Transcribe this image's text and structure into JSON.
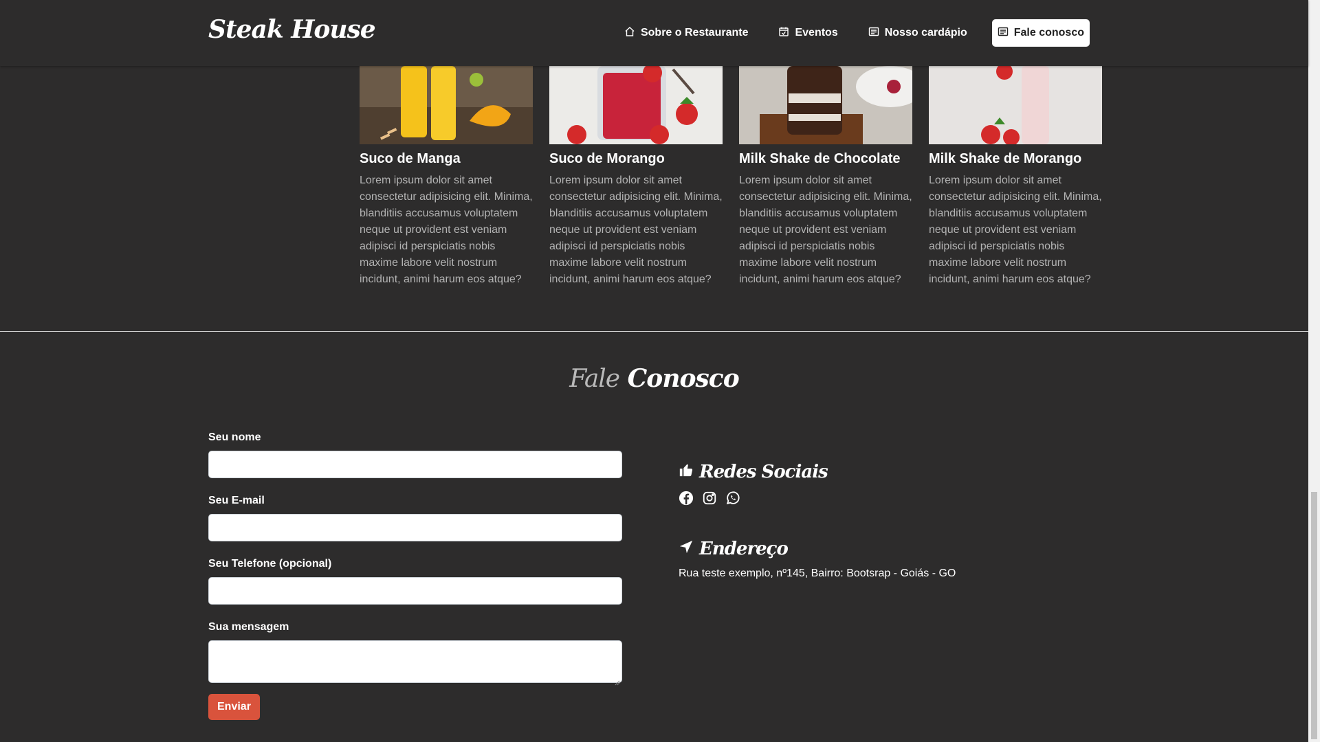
{
  "header": {
    "brand": "Steak House",
    "nav": [
      {
        "label": "Sobre o Restaurante",
        "icon": "home-icon"
      },
      {
        "label": "Eventos",
        "icon": "calendar-check-icon"
      },
      {
        "label": "Nosso cardápio",
        "icon": "menu-card-icon"
      },
      {
        "label": "Fale conosco",
        "icon": "message-icon",
        "active": true
      }
    ]
  },
  "products": [
    {
      "title": "Suco de Manga",
      "description": "Lorem ipsum dolor sit amet consectetur adipisicing elit. Minima, blanditiis accusamus voluptatem neque ut provident est veniam adipisci id perspiciatis nobis maxime labore velit nostrum incidunt, animi harum eos atque?",
      "image": "mango-juice-photo"
    },
    {
      "title": "Suco de Morango",
      "description": "Lorem ipsum dolor sit amet consectetur adipisicing elit. Minima, blanditiis accusamus voluptatem neque ut provident est veniam adipisci id perspiciatis nobis maxime labore velit nostrum incidunt, animi harum eos atque?",
      "image": "strawberry-juice-photo"
    },
    {
      "title": "Milk Shake de Chocolate",
      "description": "Lorem ipsum dolor sit amet consectetur adipisicing elit. Minima, blanditiis accusamus voluptatem neque ut provident est veniam adipisci id perspiciatis nobis maxime labore velit nostrum incidunt, animi harum eos atque?",
      "image": "chocolate-milkshake-photo"
    },
    {
      "title": "Milk Shake de Morango",
      "description": "Lorem ipsum dolor sit amet consectetur adipisicing elit. Minima, blanditiis accusamus voluptatem neque ut provident est veniam adipisci id perspiciatis nobis maxime labore velit nostrum incidunt, animi harum eos atque?",
      "image": "strawberry-milkshake-photo"
    }
  ],
  "contact": {
    "title_part1": "Fale",
    "title_part2": "Conosco",
    "form": {
      "name_label": "Seu nome",
      "name_value": "",
      "email_label": "Seu E-mail",
      "email_value": "",
      "phone_label": "Seu Telefone (opcional)",
      "phone_value": "",
      "message_label": "Sua mensagem",
      "message_value": "",
      "submit_label": "Enviar"
    },
    "social": {
      "heading": "Redes Sociais",
      "heading_icon": "thumbs-up-icon",
      "icons": [
        "facebook-icon",
        "instagram-icon",
        "whatsapp-icon"
      ]
    },
    "address": {
      "heading": "Endereço",
      "heading_icon": "location-arrow-icon",
      "text": "Rua teste exemplo, nº145, Bairro: Bootsrap - Goiás - GO"
    }
  },
  "colors": {
    "background": "#2d2c2c",
    "accent": "#d9533c",
    "muted_text": "#b3b3b3"
  }
}
